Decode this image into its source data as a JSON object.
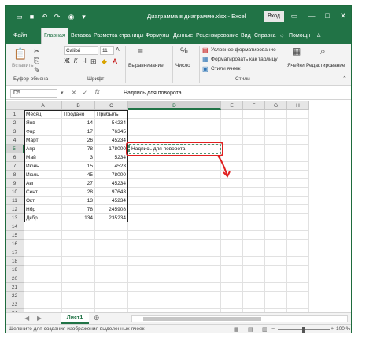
{
  "titlebar": {
    "title": "Диаграмма в диаграмме.xlsx  -  Excel",
    "signin": "Вход",
    "save_icon": "save-icon",
    "undo_icon": "undo-icon",
    "redo_icon": "redo-icon",
    "camera_icon": "camera-icon",
    "customize_icon": "customize-icon"
  },
  "tabs": [
    "Файл",
    "Главная",
    "Вставка",
    "Разметка страницы",
    "Формулы",
    "Данные",
    "Рецензирование",
    "Вид",
    "Справка",
    "Помощн",
    "Поделиться"
  ],
  "active_tab": "Главная",
  "ribbon": {
    "clipboard": {
      "paste_label": "Вставить",
      "group_label": "Буфер обмена"
    },
    "font": {
      "name": "Calibri",
      "size": "11",
      "bold": "Ж",
      "italic": "К",
      "underline": "Ч",
      "group_label": "Шрифт"
    },
    "alignment": {
      "button_label": "Выравнивание"
    },
    "number": {
      "symbol": "%",
      "label": "Число"
    },
    "styles": {
      "conditional": "Условное форматирование",
      "format_table": "Форматировать как таблицу",
      "cell_styles": "Стили ячеек",
      "group_label": "Стили"
    },
    "cells": {
      "label": "Ячейки"
    },
    "editing": {
      "label": "Редактирование"
    }
  },
  "formula_bar": {
    "name_box": "D5",
    "fx": "fx",
    "content": "Надпись для поворота"
  },
  "grid": {
    "columns": [
      "A",
      "B",
      "C",
      "D",
      "E",
      "F",
      "G",
      "H"
    ],
    "selected_column": "D",
    "selected_row": "5",
    "row_numbers": [
      "1",
      "2",
      "3",
      "4",
      "5",
      "6",
      "7",
      "8",
      "9",
      "10",
      "11",
      "12",
      "13",
      "14",
      "15",
      "16",
      "17",
      "18",
      "19",
      "20",
      "21",
      "22",
      "23",
      "24"
    ],
    "headers": [
      "Месяц",
      "Продано",
      "Прибыль"
    ],
    "rows": [
      [
        "Янв",
        "14",
        "54234"
      ],
      [
        "Фвр",
        "17",
        "76345"
      ],
      [
        "Март",
        "26",
        "45234"
      ],
      [
        "Апр",
        "78",
        "178000"
      ],
      [
        "Май",
        "3",
        "5234"
      ],
      [
        "Июнь",
        "15",
        "4523"
      ],
      [
        "Июль",
        "45",
        "78000"
      ],
      [
        "Авг",
        "27",
        "45234"
      ],
      [
        "Сент",
        "28",
        "97643"
      ],
      [
        "Окт",
        "13",
        "45234"
      ],
      [
        "Нбр",
        "78",
        "245908"
      ],
      [
        "Дкбр",
        "134",
        "235234"
      ]
    ],
    "callout_text": "Надпись для поворота",
    "highlight_color": "#e02020",
    "accent_color": "#217346"
  },
  "sheets": {
    "active": "Лист1",
    "add_icon": "plus-icon"
  },
  "status": {
    "text": "Щелкните для создания изображения выделенных ячеек",
    "zoom": "100 %"
  }
}
